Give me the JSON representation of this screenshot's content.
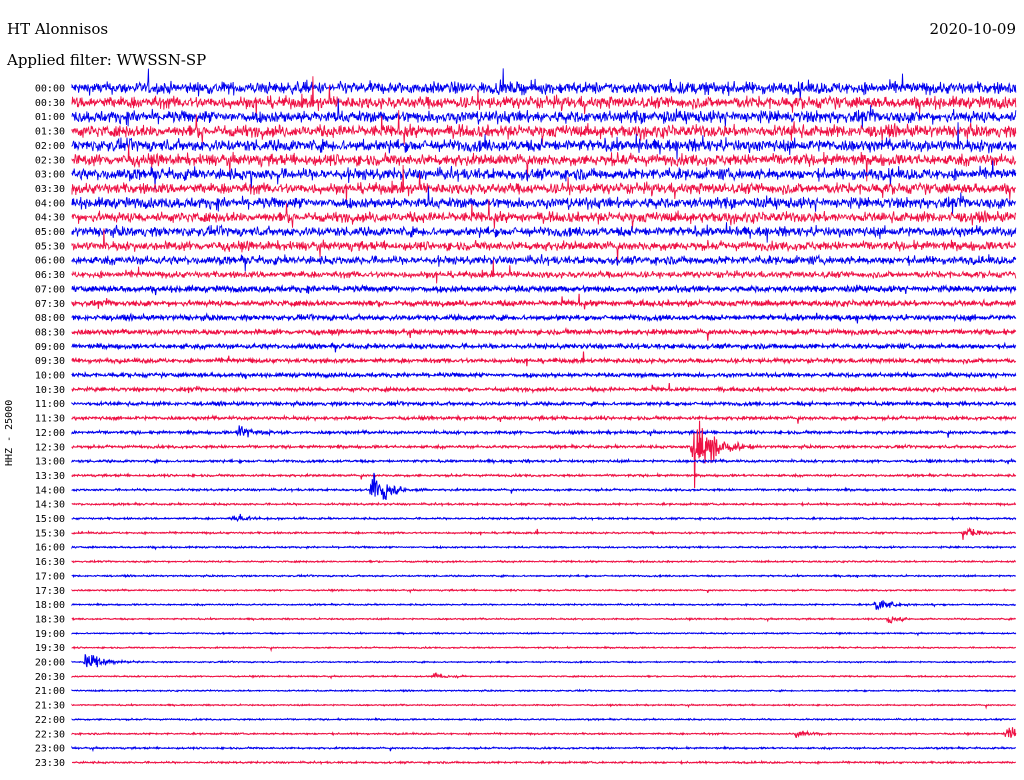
{
  "header": {
    "station": "HT Alonnisos",
    "filter": "Applied filter: WWSSN-SP",
    "date": "2020-10-09"
  },
  "colors": {
    "blue": "#0000ee",
    "red": "#ee1144",
    "background": "#ffffff"
  },
  "chart_data": {
    "type": "line",
    "title": "HT Alonnisos",
    "subtitle": "Applied filter: WWSSN-SP",
    "ylabel": "HHZ - 25000",
    "xlabel": "",
    "row_colors": [
      "blue",
      "red"
    ],
    "categories": [
      "00:00",
      "00:30",
      "01:00",
      "01:30",
      "02:00",
      "02:30",
      "03:00",
      "03:30",
      "04:00",
      "04:30",
      "05:00",
      "05:30",
      "06:00",
      "06:30",
      "07:00",
      "07:30",
      "08:00",
      "08:30",
      "09:00",
      "09:30",
      "10:00",
      "10:30",
      "11:00",
      "11:30",
      "12:00",
      "12:30",
      "13:00",
      "13:30",
      "14:00",
      "14:30",
      "15:00",
      "15:30",
      "16:00",
      "16:30",
      "17:00",
      "17:30",
      "18:00",
      "18:30",
      "19:00",
      "19:30",
      "20:00",
      "20:30",
      "21:00",
      "21:30",
      "22:00",
      "22:30",
      "23:00",
      "23:30"
    ],
    "noise_level": [
      1.0,
      1.0,
      1.0,
      1.0,
      1.0,
      0.95,
      0.95,
      0.9,
      0.9,
      0.85,
      0.8,
      0.75,
      0.7,
      0.55,
      0.5,
      0.45,
      0.42,
      0.4,
      0.38,
      0.35,
      0.33,
      0.3,
      0.28,
      0.26,
      0.24,
      0.22,
      0.2,
      0.18,
      0.17,
      0.16,
      0.15,
      0.15,
      0.14,
      0.13,
      0.13,
      0.12,
      0.12,
      0.12,
      0.11,
      0.11,
      0.11,
      0.11,
      0.11,
      0.11,
      0.12,
      0.13,
      0.14,
      0.15
    ],
    "events": [
      {
        "row": "12:00",
        "minute": 5.3,
        "amplitude": 0.9
      },
      {
        "row": "12:30",
        "minute": 19.7,
        "amplitude": 6.0
      },
      {
        "row": "14:00",
        "minute": 9.5,
        "amplitude": 2.4
      },
      {
        "row": "15:00",
        "minute": 5.1,
        "amplitude": 0.6
      },
      {
        "row": "15:30",
        "minute": 28.3,
        "amplitude": 1.0
      },
      {
        "row": "18:00",
        "minute": 25.5,
        "amplitude": 0.8
      },
      {
        "row": "18:30",
        "minute": 25.9,
        "amplitude": 0.5
      },
      {
        "row": "20:00",
        "minute": 0.4,
        "amplitude": 1.2
      },
      {
        "row": "20:30",
        "minute": 11.5,
        "amplitude": 0.4
      },
      {
        "row": "22:30",
        "minute": 23.0,
        "amplitude": 0.4
      },
      {
        "row": "22:30",
        "minute": 29.7,
        "amplitude": 1.3
      }
    ]
  }
}
